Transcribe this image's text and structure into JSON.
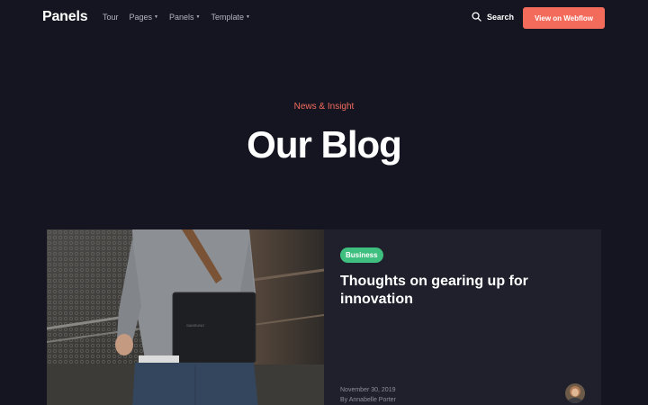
{
  "nav": {
    "logo": "Panels",
    "links": [
      {
        "label": "Tour",
        "has_dropdown": false
      },
      {
        "label": "Pages",
        "has_dropdown": true
      },
      {
        "label": "Panels",
        "has_dropdown": true
      },
      {
        "label": "Template",
        "has_dropdown": true
      }
    ],
    "search_label": "Search",
    "search_icon": "search-icon",
    "cta_label": "View on Webflow"
  },
  "hero": {
    "eyebrow": "News & Insight",
    "title": "Our Blog"
  },
  "post": {
    "category": "Business",
    "title": "Thoughts on gearing up for innovation",
    "date": "November 30, 2019",
    "author": "By Annabelle Porter",
    "image_label": "SAMSUNG"
  },
  "colors": {
    "background": "#151521",
    "card": "#20202c",
    "accent": "#f26b5b",
    "badge": "#3fbf7f"
  }
}
